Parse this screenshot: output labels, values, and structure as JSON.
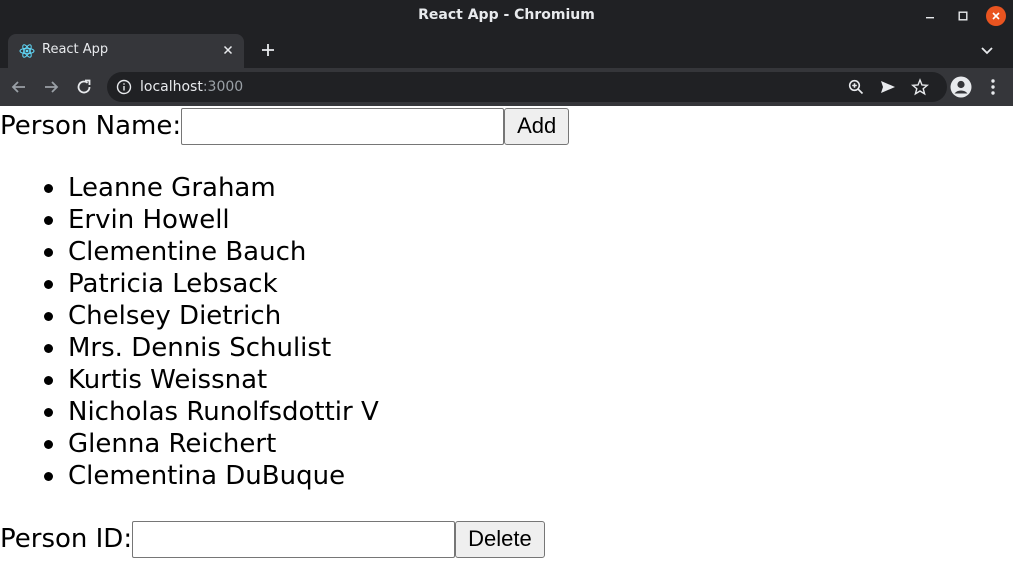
{
  "window": {
    "title": "React App - Chromium",
    "colors": {
      "titlebar": "#202124",
      "close": "#e95420"
    }
  },
  "tabs": [
    {
      "label": "React App",
      "icon": "react-icon",
      "active": true
    }
  ],
  "toolbar": {
    "url_host": "localhost",
    "url_port": ":3000",
    "icons": [
      "back-arrow-icon",
      "forward-arrow-icon",
      "reload-icon",
      "info-icon",
      "zoom-icon",
      "send-icon",
      "star-icon",
      "profile-icon",
      "menu-icon"
    ]
  },
  "page": {
    "add_form": {
      "label": "Person Name:",
      "value": "",
      "button": "Add"
    },
    "people": [
      "Leanne Graham",
      "Ervin Howell",
      "Clementine Bauch",
      "Patricia Lebsack",
      "Chelsey Dietrich",
      "Mrs. Dennis Schulist",
      "Kurtis Weissnat",
      "Nicholas Runolfsdottir V",
      "Glenna Reichert",
      "Clementina DuBuque"
    ],
    "delete_form": {
      "label": "Person ID:",
      "value": "",
      "button": "Delete"
    }
  }
}
